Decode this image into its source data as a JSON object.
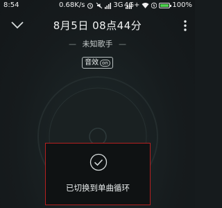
{
  "status_bar": {
    "time": "8:54",
    "net_speed": "0.68K/s",
    "network_1": "3G",
    "network_2": "4G+",
    "battery": "100%",
    "battery_level": 1.0
  },
  "header": {
    "title": "8月5日 08点44分",
    "artist": "未知歌手",
    "effect_label": "音效",
    "effect_badge": "on"
  },
  "toast": {
    "message": "已切换到单曲循环"
  },
  "colors": {
    "background": "#161b1d",
    "accent_green": "#4fd14f",
    "toast_border": "#b52020"
  }
}
